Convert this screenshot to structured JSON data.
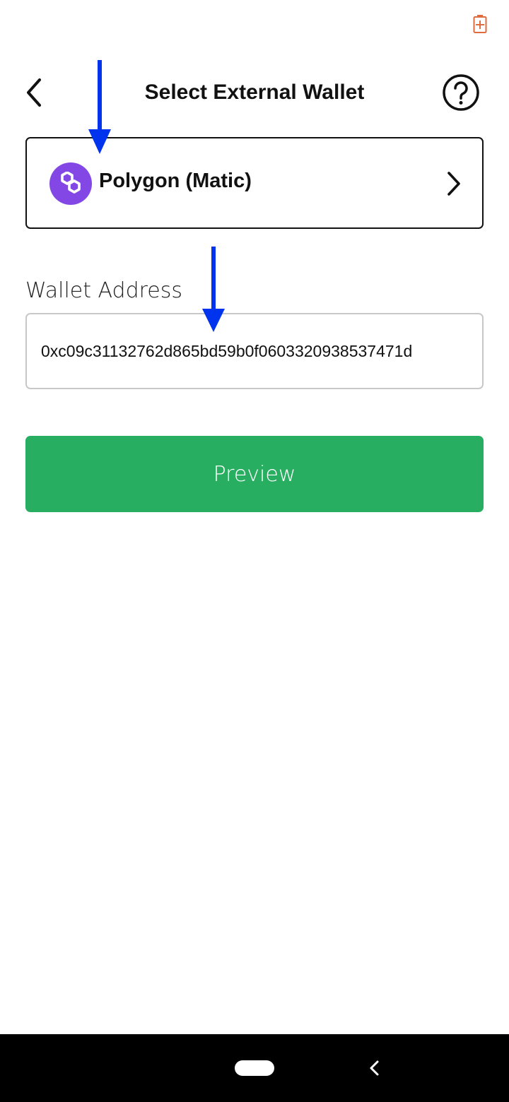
{
  "status_bar": {
    "battery_icon": "battery-charging-icon",
    "battery_color": "#e06b3e"
  },
  "header": {
    "title": "Select External Wallet",
    "back_icon": "chevron-left-icon",
    "help_icon": "question-circle-icon"
  },
  "network": {
    "name": "Polygon (Matic)",
    "logo_icon": "polygon-logo-icon",
    "logo_color": "#8247e5",
    "chevron_icon": "chevron-right-icon"
  },
  "wallet_address": {
    "label": "Wallet Address",
    "value": "0xc09c31132762d865bd59b0f0603320938537471d"
  },
  "actions": {
    "preview_label": "Preview",
    "preview_color": "#27ae60"
  },
  "annotations": {
    "arrow_color": "#0033ee",
    "arrow_icon": "arrow-down-icon"
  },
  "system_nav": {
    "home_icon": "home-pill-icon",
    "back_icon": "nav-back-icon"
  }
}
